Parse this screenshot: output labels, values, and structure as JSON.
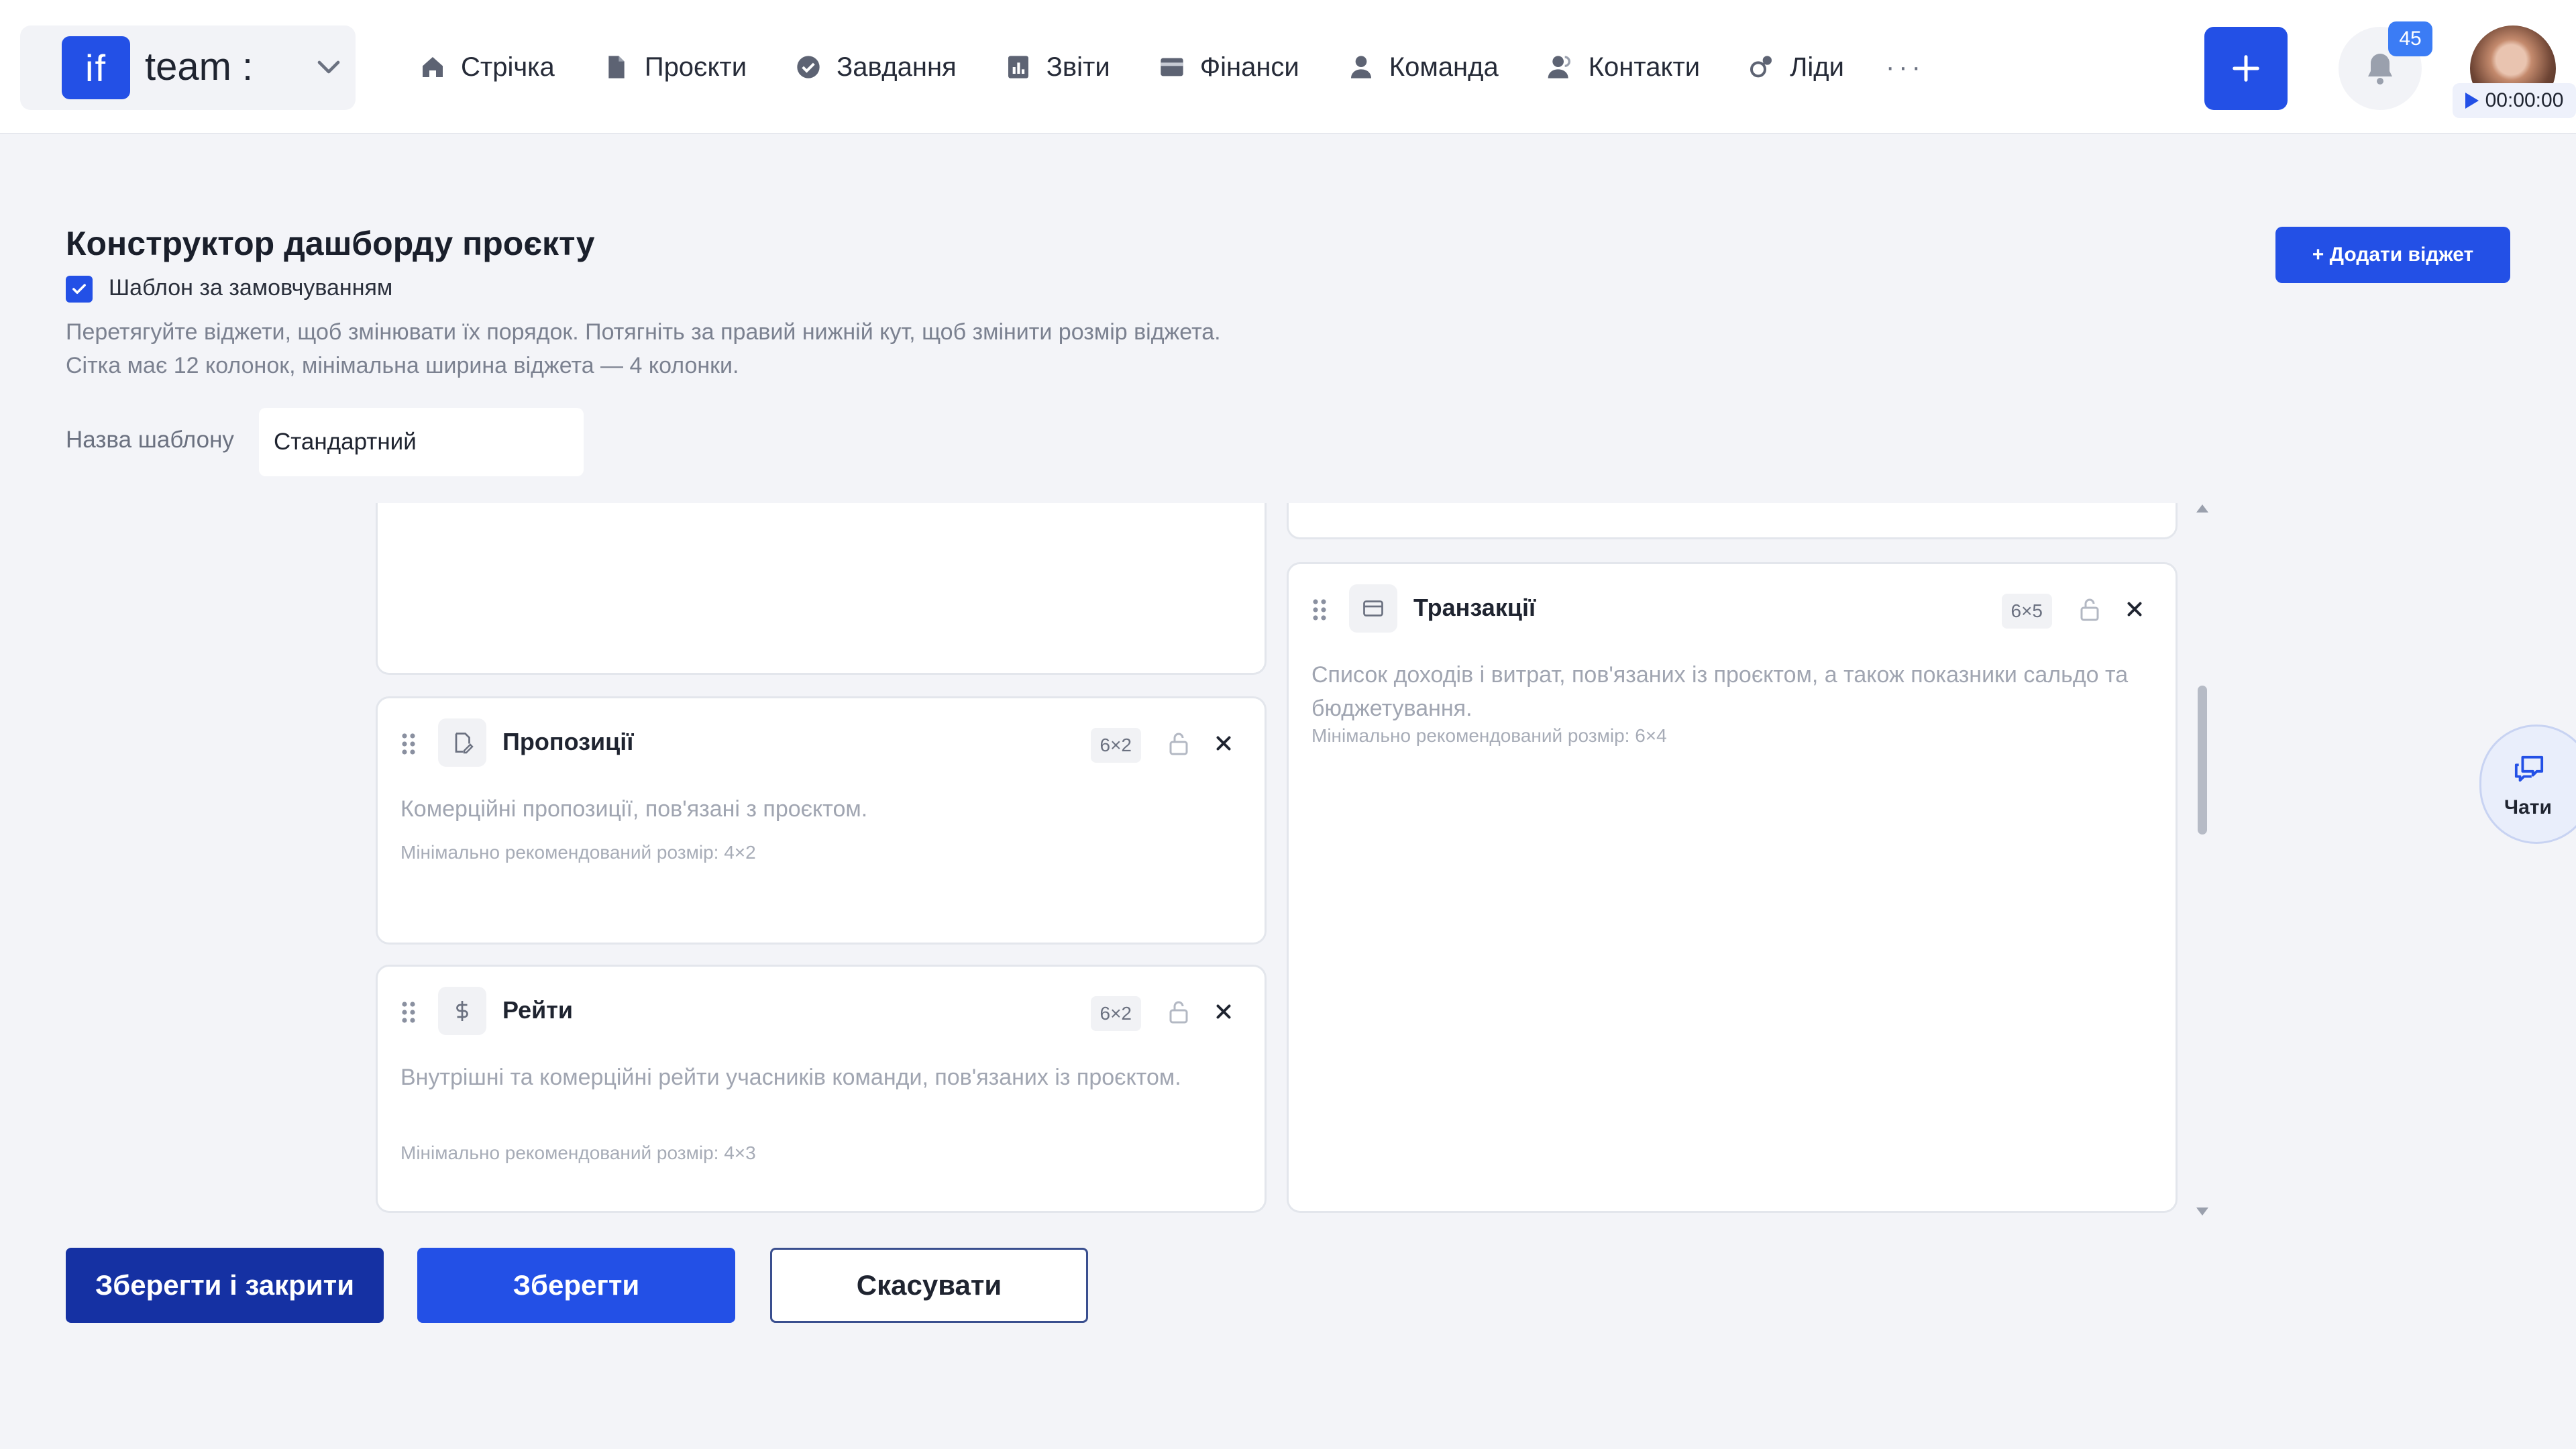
{
  "topbar": {
    "logo_text": "if",
    "team_name": "team :",
    "nav": [
      {
        "label": "Стрічка",
        "icon": "home-icon"
      },
      {
        "label": "Проєкти",
        "icon": "file-icon"
      },
      {
        "label": "Завдання",
        "icon": "check-circle-icon"
      },
      {
        "label": "Звіти",
        "icon": "report-icon"
      },
      {
        "label": "Фінанси",
        "icon": "wallet-icon"
      },
      {
        "label": "Команда",
        "icon": "user-icon"
      },
      {
        "label": "Контакти",
        "icon": "contacts-icon"
      },
      {
        "label": "Ліди",
        "icon": "leads-icon"
      }
    ],
    "more": "···",
    "notification_count": "45",
    "timer": "00:00:00"
  },
  "page": {
    "title": "Конструктор дашборду проєкту",
    "default_template_label": "Шаблон за замовчуванням",
    "default_template_checked": true,
    "hint": "Перетягуйте віджети, щоб змінювати їх порядок. Потягніть за правий нижній кут, щоб змінити розмір віджета. Сітка має 12 колонок, мінімальна ширина віджета — 4 колонки.",
    "template_name_label": "Назва шаблону",
    "template_name_value": "Стандартний",
    "add_widget_label": "+ Додати віджет"
  },
  "widgets": [
    {
      "title": "Пропозиції",
      "icon": "proposal-icon",
      "size": "6×2",
      "description": "Комерційні пропозиції, пов'язані з проєктом.",
      "min_size": "Мінімально рекомендований розмір: 4×2"
    },
    {
      "title": "Рейти",
      "icon": "dollar-icon",
      "size": "6×2",
      "description": "Внутрішні та комерційні рейти учасників команди, пов'язаних із проєктом.",
      "min_size": "Мінімально рекомендований розмір: 4×3"
    },
    {
      "title": "Транзакції",
      "icon": "card-icon",
      "size": "6×5",
      "description": "Список доходів і витрат, пов'язаних із проєктом, а також показники сальдо та бюджетування.",
      "min_size": "Мінімально рекомендований розмір: 6×4"
    }
  ],
  "chats_label": "Чати",
  "footer": {
    "save_close": "Зберегти і закрити",
    "save": "Зберегти",
    "cancel": "Скасувати"
  },
  "colors": {
    "accent": "#2350e6",
    "dark_accent": "#1531a3",
    "background": "#f3f4f8"
  }
}
